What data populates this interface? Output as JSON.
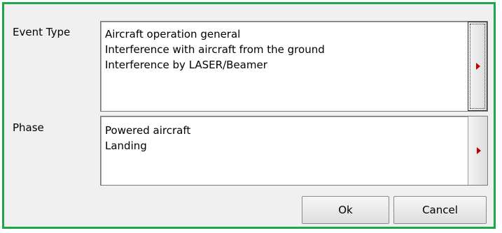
{
  "event_type": {
    "label": "Event Type",
    "items": [
      "Aircraft operation general",
      "Interference with aircraft from the ground",
      "Interference by LASER/Beamer"
    ]
  },
  "phase": {
    "label": "Phase",
    "items": [
      "Powered aircraft",
      "Landing"
    ]
  },
  "buttons": {
    "ok_label": "Ok",
    "cancel_label": "Cancel"
  },
  "colors": {
    "border_accent": "#1aa84a",
    "arrow": "#c00000",
    "panel_background": "#f0f0f0"
  },
  "icons": {
    "expand": "red-right-triangle-icon"
  }
}
